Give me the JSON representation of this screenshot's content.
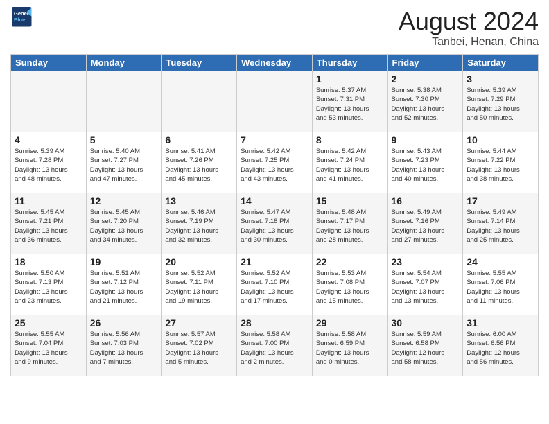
{
  "header": {
    "logo_line1": "General",
    "logo_line2": "Blue",
    "title": "August 2024",
    "location": "Tanbei, Henan, China"
  },
  "weekdays": [
    "Sunday",
    "Monday",
    "Tuesday",
    "Wednesday",
    "Thursday",
    "Friday",
    "Saturday"
  ],
  "weeks": [
    [
      {
        "day": "",
        "info": ""
      },
      {
        "day": "",
        "info": ""
      },
      {
        "day": "",
        "info": ""
      },
      {
        "day": "",
        "info": ""
      },
      {
        "day": "1",
        "info": "Sunrise: 5:37 AM\nSunset: 7:31 PM\nDaylight: 13 hours\nand 53 minutes."
      },
      {
        "day": "2",
        "info": "Sunrise: 5:38 AM\nSunset: 7:30 PM\nDaylight: 13 hours\nand 52 minutes."
      },
      {
        "day": "3",
        "info": "Sunrise: 5:39 AM\nSunset: 7:29 PM\nDaylight: 13 hours\nand 50 minutes."
      }
    ],
    [
      {
        "day": "4",
        "info": "Sunrise: 5:39 AM\nSunset: 7:28 PM\nDaylight: 13 hours\nand 48 minutes."
      },
      {
        "day": "5",
        "info": "Sunrise: 5:40 AM\nSunset: 7:27 PM\nDaylight: 13 hours\nand 47 minutes."
      },
      {
        "day": "6",
        "info": "Sunrise: 5:41 AM\nSunset: 7:26 PM\nDaylight: 13 hours\nand 45 minutes."
      },
      {
        "day": "7",
        "info": "Sunrise: 5:42 AM\nSunset: 7:25 PM\nDaylight: 13 hours\nand 43 minutes."
      },
      {
        "day": "8",
        "info": "Sunrise: 5:42 AM\nSunset: 7:24 PM\nDaylight: 13 hours\nand 41 minutes."
      },
      {
        "day": "9",
        "info": "Sunrise: 5:43 AM\nSunset: 7:23 PM\nDaylight: 13 hours\nand 40 minutes."
      },
      {
        "day": "10",
        "info": "Sunrise: 5:44 AM\nSunset: 7:22 PM\nDaylight: 13 hours\nand 38 minutes."
      }
    ],
    [
      {
        "day": "11",
        "info": "Sunrise: 5:45 AM\nSunset: 7:21 PM\nDaylight: 13 hours\nand 36 minutes."
      },
      {
        "day": "12",
        "info": "Sunrise: 5:45 AM\nSunset: 7:20 PM\nDaylight: 13 hours\nand 34 minutes."
      },
      {
        "day": "13",
        "info": "Sunrise: 5:46 AM\nSunset: 7:19 PM\nDaylight: 13 hours\nand 32 minutes."
      },
      {
        "day": "14",
        "info": "Sunrise: 5:47 AM\nSunset: 7:18 PM\nDaylight: 13 hours\nand 30 minutes."
      },
      {
        "day": "15",
        "info": "Sunrise: 5:48 AM\nSunset: 7:17 PM\nDaylight: 13 hours\nand 28 minutes."
      },
      {
        "day": "16",
        "info": "Sunrise: 5:49 AM\nSunset: 7:16 PM\nDaylight: 13 hours\nand 27 minutes."
      },
      {
        "day": "17",
        "info": "Sunrise: 5:49 AM\nSunset: 7:14 PM\nDaylight: 13 hours\nand 25 minutes."
      }
    ],
    [
      {
        "day": "18",
        "info": "Sunrise: 5:50 AM\nSunset: 7:13 PM\nDaylight: 13 hours\nand 23 minutes."
      },
      {
        "day": "19",
        "info": "Sunrise: 5:51 AM\nSunset: 7:12 PM\nDaylight: 13 hours\nand 21 minutes."
      },
      {
        "day": "20",
        "info": "Sunrise: 5:52 AM\nSunset: 7:11 PM\nDaylight: 13 hours\nand 19 minutes."
      },
      {
        "day": "21",
        "info": "Sunrise: 5:52 AM\nSunset: 7:10 PM\nDaylight: 13 hours\nand 17 minutes."
      },
      {
        "day": "22",
        "info": "Sunrise: 5:53 AM\nSunset: 7:08 PM\nDaylight: 13 hours\nand 15 minutes."
      },
      {
        "day": "23",
        "info": "Sunrise: 5:54 AM\nSunset: 7:07 PM\nDaylight: 13 hours\nand 13 minutes."
      },
      {
        "day": "24",
        "info": "Sunrise: 5:55 AM\nSunset: 7:06 PM\nDaylight: 13 hours\nand 11 minutes."
      }
    ],
    [
      {
        "day": "25",
        "info": "Sunrise: 5:55 AM\nSunset: 7:04 PM\nDaylight: 13 hours\nand 9 minutes."
      },
      {
        "day": "26",
        "info": "Sunrise: 5:56 AM\nSunset: 7:03 PM\nDaylight: 13 hours\nand 7 minutes."
      },
      {
        "day": "27",
        "info": "Sunrise: 5:57 AM\nSunset: 7:02 PM\nDaylight: 13 hours\nand 5 minutes."
      },
      {
        "day": "28",
        "info": "Sunrise: 5:58 AM\nSunset: 7:00 PM\nDaylight: 13 hours\nand 2 minutes."
      },
      {
        "day": "29",
        "info": "Sunrise: 5:58 AM\nSunset: 6:59 PM\nDaylight: 13 hours\nand 0 minutes."
      },
      {
        "day": "30",
        "info": "Sunrise: 5:59 AM\nSunset: 6:58 PM\nDaylight: 12 hours\nand 58 minutes."
      },
      {
        "day": "31",
        "info": "Sunrise: 6:00 AM\nSunset: 6:56 PM\nDaylight: 12 hours\nand 56 minutes."
      }
    ]
  ]
}
